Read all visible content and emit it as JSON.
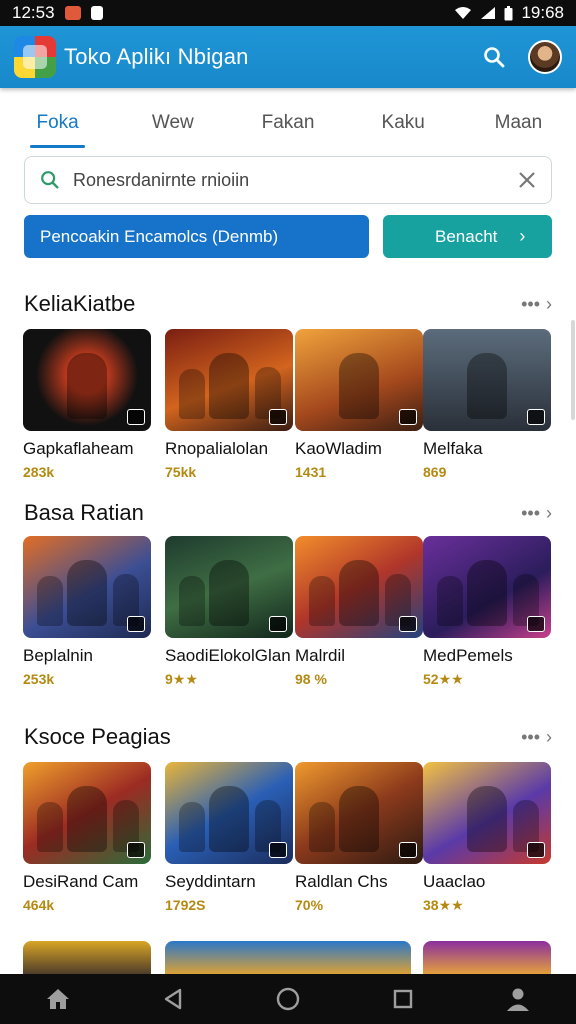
{
  "status_bar": {
    "time_left": "12:53",
    "time_right": "19:68"
  },
  "app_bar": {
    "title": "Toko Aplikı Nbigan",
    "logo_icon": "app-store-logo-icon",
    "search_icon": "search-icon",
    "avatar_icon": "user-avatar"
  },
  "tabs": [
    {
      "label": "Foka",
      "active": true
    },
    {
      "label": "Wew",
      "active": false
    },
    {
      "label": "Fakan",
      "active": false
    },
    {
      "label": "Kaku",
      "active": false
    },
    {
      "label": "Maan",
      "active": false
    }
  ],
  "search": {
    "placeholder": "Ronesrdanirnte rnioiin"
  },
  "actions": {
    "primary_label": "Pencoakin Encamolcs (Denmb)",
    "secondary_label": "Benacht"
  },
  "colors": {
    "appbar": "#1f95d6",
    "primary_button": "#1673c9",
    "secondary_button": "#17a2a0",
    "active_tab": "#1479c6"
  },
  "sections": [
    {
      "title": "KeliaKiatbe",
      "apps": [
        {
          "name": "Gapkaflaheam",
          "rating": "283k"
        },
        {
          "name": "Rnopalialolan",
          "rating": "75kk"
        },
        {
          "name": "KaoWladim",
          "rating": "1431"
        },
        {
          "name": "Melfaka",
          "rating": "869"
        }
      ]
    },
    {
      "title": "Basa Ratian",
      "apps": [
        {
          "name": "Beplalnin",
          "rating": "253k"
        },
        {
          "name": "SaodiElokolGlan",
          "rating": "9★★"
        },
        {
          "name": "Malrdil",
          "rating": "98 %"
        },
        {
          "name": "MedPemels",
          "rating": "52★★"
        }
      ]
    },
    {
      "title": "Ksoce Peagias",
      "apps": [
        {
          "name": "DesiRand Cam",
          "rating": "464k"
        },
        {
          "name": "Seyddintarn",
          "rating": "1792S"
        },
        {
          "name": "Raldlan Chs",
          "rating": "70%"
        },
        {
          "name": "Uaaclao",
          "rating": "38★★"
        }
      ]
    }
  ]
}
